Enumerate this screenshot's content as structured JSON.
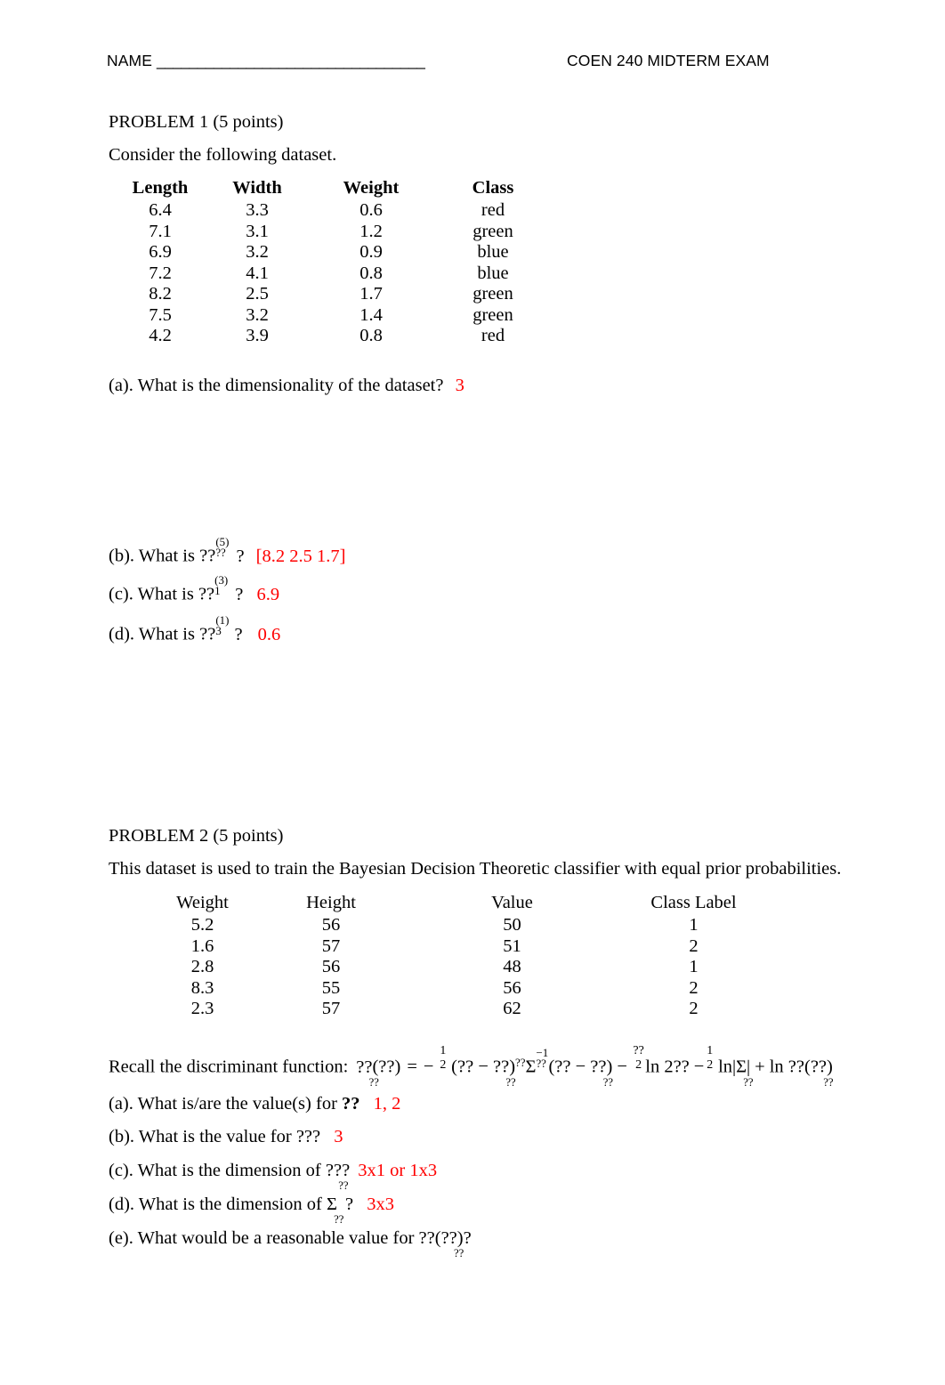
{
  "header": {
    "name_label": "NAME",
    "name_rule": "_________________________________",
    "exam_title": "COEN 240 MIDTERM EXAM"
  },
  "problem1": {
    "heading": "PROBLEM 1 (5 points)",
    "intro": "Consider the following dataset.",
    "table": {
      "columns": [
        "Length",
        "Width",
        "Weight",
        "Class"
      ],
      "rows": [
        [
          "6.4",
          "3.3",
          "0.6",
          "red"
        ],
        [
          "7.1",
          "3.1",
          "1.2",
          "green"
        ],
        [
          "6.9",
          "3.2",
          "0.9",
          "blue"
        ],
        [
          "7.2",
          "4.1",
          "0.8",
          "blue"
        ],
        [
          "8.2",
          "2.5",
          "1.7",
          "green"
        ],
        [
          "7.5",
          "3.2",
          "1.4",
          "green"
        ],
        [
          "4.2",
          "3.9",
          "0.8",
          "red"
        ]
      ]
    },
    "questions": {
      "a": {
        "prefix": "(a). What is the dimensionality of the dataset?",
        "answer": "3"
      },
      "b": {
        "prefix": "(b). What is",
        "var": "??",
        "sup": "(5)",
        "sub": "??",
        "suffix": "?",
        "answer": "[8.2  2.5  1.7]"
      },
      "c": {
        "prefix": "(c). What is",
        "var": "??",
        "sup": "(3)",
        "sub": "1",
        "suffix": "?",
        "answer": "6.9"
      },
      "d": {
        "prefix": "(d). What is",
        "var": "??",
        "sup": "(1)",
        "sub": "3",
        "suffix": "?",
        "answer": "0.6"
      }
    }
  },
  "problem2": {
    "heading": "PROBLEM 2 (5 points)",
    "intro": "This dataset is used to train the Bayesian Decision Theoretic classifier with equal prior probabilities.",
    "table": {
      "columns": [
        "Weight",
        "Height",
        "Value",
        "Class Label"
      ],
      "rows": [
        [
          "5.2",
          "56",
          "50",
          "1"
        ],
        [
          "1.6",
          "57",
          "51",
          "2"
        ],
        [
          "2.8",
          "56",
          "48",
          "1"
        ],
        [
          "8.3",
          "55",
          "56",
          "2"
        ],
        [
          "2.3",
          "57",
          "62",
          "2"
        ]
      ]
    },
    "formula": {
      "label": "Recall the discriminant function:",
      "g": "??",
      "g_sub": "??",
      "open_x": "(??)",
      "equals": "=",
      "minus": "−",
      "half_num": "1",
      "half_den": "2",
      "term1_open": "(?? − ??",
      "term1_sub": "??",
      "term1_close": ")",
      "transpose": "??",
      "sigma": "Σ",
      "sigma_sup": "−1",
      "sigma_sub": "??",
      "term2_open": "(?? − ??",
      "term2_sub": "??",
      "term2_close": ")",
      "minus2": "−",
      "d_num": "??",
      "d_den": "2",
      "ln2pi": "ln 2??",
      "minus3": "−",
      "half2_num": "1",
      "half2_den": "2",
      "lndet": "ln|Σ",
      "lndet_sub": "??",
      "lndet_close": "|",
      "plus": "+",
      "lnp": "ln ??(??",
      "lnp_sub": "??",
      "lnp_close": ")"
    },
    "questions": {
      "a": {
        "prefix": "(a). What is/are the value(s) for",
        "var": "??",
        "answer": "1, 2"
      },
      "b": {
        "prefix": "(b). What is the value for",
        "var": "??",
        "suffix": "?",
        "answer": "3"
      },
      "c": {
        "prefix": "(c). What is the dimension of",
        "var": "??",
        "sub": "??",
        "suffix": "?",
        "answer": "3x1 or 1x3"
      },
      "d": {
        "prefix": "(d). What is the dimension of",
        "var": "Σ",
        "sub": "??",
        "suffix": "?",
        "answer": "3x3"
      },
      "e": {
        "prefix": "(e). What would be a reasonable value for",
        "var": "??(??",
        "sub": "??",
        "suffix": ")?",
        "answer": ""
      }
    }
  },
  "colors": {
    "answer_red": "#FF0000",
    "text_black": "#000000",
    "page_background": "#FFFFFF"
  }
}
